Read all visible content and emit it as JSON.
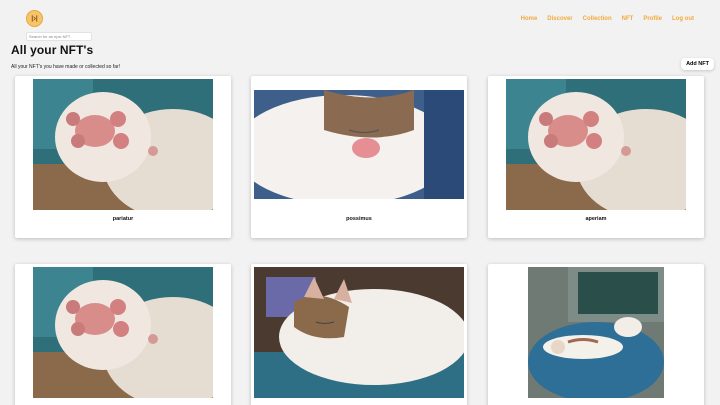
{
  "header": {
    "logo_name": "coin-logo-icon",
    "search_placeholder": "Search for an epic NFT",
    "nav": [
      "Home",
      "Discover",
      "Collection",
      "NFT",
      "Profile",
      "Log out"
    ],
    "accent_color": "#f3a93c"
  },
  "main": {
    "title": "All your NFT's",
    "subtitle": "All your NFT's you have made or collected so far!",
    "add_button": "Add NFT"
  },
  "cards": [
    {
      "name": "pariatur",
      "image": "cat-paw"
    },
    {
      "name": "possimus",
      "image": "sleeping-cat-closeup"
    },
    {
      "name": "aperiam",
      "image": "cat-paw"
    },
    {
      "name": "",
      "image": "cat-paw"
    },
    {
      "name": "",
      "image": "sleeping-cat-blanket"
    },
    {
      "name": "",
      "image": "cat-on-blue-blanket"
    }
  ]
}
